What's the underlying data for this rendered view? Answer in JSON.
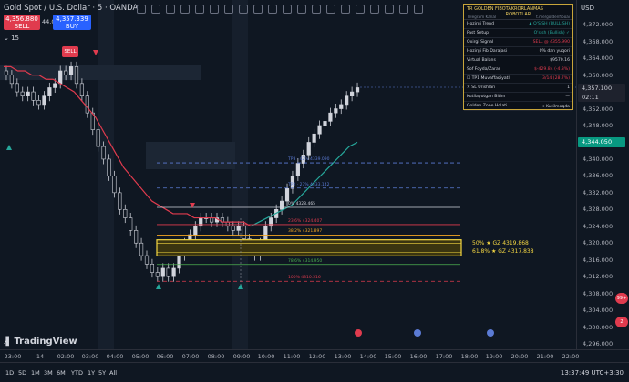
{
  "header": {
    "title": "Gold Spot / U.S. Dollar · 5 · OANDA",
    "sell_price": "4,356.880",
    "sell_label": "SELL",
    "buy_price": "4,357.339",
    "buy_label": "BUY",
    "spread": "44.0",
    "indicator_count": "15"
  },
  "chart_data": {
    "type": "candlestick",
    "price_ticks": [
      "4,372.000",
      "4,368.000",
      "4,364.000",
      "4,360.000",
      "4,356.000",
      "4,352.000",
      "4,348.000",
      "4,344.000",
      "4,340.000",
      "4,336.000",
      "4,332.000",
      "4,328.000",
      "4,324.000",
      "4,320.000",
      "4,316.000",
      "4,312.000",
      "4,308.000",
      "4,304.000",
      "4,300.000",
      "4,296.000"
    ],
    "time_ticks": [
      "23:00",
      "14",
      "02:00",
      "03:00",
      "04:00",
      "05:00",
      "06:00",
      "07:00",
      "08:00",
      "09:00",
      "10:00",
      "11:00",
      "12:00",
      "13:00",
      "14:00",
      "15:00",
      "16:00",
      "17:00",
      "18:00",
      "19:00",
      "20:00",
      "21:00",
      "22:00"
    ],
    "current_price": "4,357.100",
    "countdown": "02:11",
    "green_price_label": "4,344.050",
    "y_range": [
      4296,
      4374
    ],
    "fib_levels": [
      {
        "label": "TP3 · 42%  4339.090",
        "price": 4339.1,
        "color": "#5b7bd5"
      },
      {
        "label": "TP2 · 27%  4333.142",
        "price": 4333.1,
        "color": "#5b7bd5"
      },
      {
        "label": "0%  4328.465",
        "price": 4328.5,
        "color": "#d1d4dc"
      },
      {
        "label": "23.6%  4324.407",
        "price": 4324.4,
        "color": "#e03b4e"
      },
      {
        "label": "38.2%  4321.897",
        "price": 4321.9,
        "color": "#f5a623"
      },
      {
        "label": "78.6%  4314.950",
        "price": 4314.9,
        "color": "#4caf50"
      },
      {
        "label": "100%  4310.516",
        "price": 4310.9,
        "color": "#e03b4e"
      }
    ],
    "golden_zone": [
      {
        "label": "50% ★ GZ  4319.868",
        "price": 4319.9
      },
      {
        "label": "61.8% ★ GZ  4317.838",
        "price": 4317.8
      }
    ],
    "close_series": [
      4360,
      4358,
      4356,
      4355,
      4356,
      4354,
      4353,
      4355,
      4357,
      4358,
      4361,
      4360,
      4362,
      4358,
      4355,
      4351,
      4347,
      4343,
      4340,
      4336,
      4332,
      4328,
      4326,
      4323,
      4320,
      4317,
      4315,
      4313,
      4312,
      4314,
      4312,
      4314,
      4317,
      4320,
      4322,
      4324,
      4326,
      4326,
      4325,
      4326,
      4325,
      4324,
      4323,
      4324,
      4321,
      4318,
      4317,
      4320,
      4324,
      4326,
      4328,
      4330,
      4333,
      4336,
      4339,
      4341,
      4344,
      4346,
      4348,
      4349,
      4351,
      4352,
      4353,
      4355,
      4356,
      4357
    ],
    "ema_red": [
      4362,
      4362,
      4361,
      4361,
      4360,
      4360,
      4359,
      4359,
      4358,
      4357,
      4356,
      4354,
      4352,
      4350,
      4347,
      4344,
      4341,
      4338,
      4336,
      4334,
      4332,
      4330,
      4329,
      4328,
      4327,
      4327,
      4327,
      4326,
      4326,
      4326,
      4326,
      4325,
      4325,
      4325,
      4325,
      4324
    ],
    "ema_green": [
      4324,
      4325,
      4326,
      4327,
      4328,
      4329,
      4331,
      4333,
      4335,
      4337,
      4339,
      4341,
      4343,
      4344
    ]
  },
  "panel": {
    "title": "TR GOLDEN FIBO",
    "title_right": "TAKRORLANMAS ROBOTLAR",
    "subtitle": "Telegram Kanal",
    "subtitle_right": "t.me/goldenfiboai",
    "rows": [
      {
        "label": "Hozirgi Trend",
        "value": "▲ O'SISH (BULLISH)",
        "color": "#26a69a"
      },
      {
        "label": "Fast Setup",
        "value": "O'sish (Bullish) ✓",
        "color": "#26a69a"
      },
      {
        "label": "Oxirgi Signal",
        "value": "SELL @ 4355.990",
        "color": "#e03b4e"
      },
      {
        "label": "Hozirgi Fib Darajasi",
        "value": "0% dan yuqori",
        "color": "#d1d4dc"
      },
      {
        "label": "Virtual Balans",
        "value": "$9570.16",
        "color": "#d1d4dc"
      },
      {
        "label": "Sof Foyda/Zarar",
        "value": "$-429.84 (-4.3%)",
        "color": "#e03b4e"
      },
      {
        "label": "☐ TP1 Muvaffaqiyatli",
        "value": "3/14 (28.7%)",
        "color": "#e03b4e"
      },
      {
        "label": "✕ SL Urishlari",
        "value": "1",
        "color": "#d1d4dc"
      },
      {
        "label": "Kutilayotgan Bitim",
        "value": "—",
        "color": "#d1d4dc"
      },
      {
        "label": "Golden Zone Holati",
        "value": "⏸ Kutilmoqda",
        "color": "#d1d4dc"
      }
    ]
  },
  "markers": {
    "sell_label": "SELL"
  },
  "bottom": {
    "ranges": [
      "1D",
      "5D",
      "1M",
      "3M",
      "6M",
      "YTD",
      "1Y",
      "5Y",
      "All"
    ],
    "clock": "13:37:49 UTC+3:30",
    "currency": "USD",
    "logo": "TradingView",
    "badge_top": "99+",
    "badge_bottom": "2"
  },
  "colors": {
    "up": "#d1d4dc",
    "down": "#d1d4dc",
    "ema_red": "#e03b4e",
    "ema_green": "#26a69a",
    "gz_fill": "#f5d742"
  }
}
